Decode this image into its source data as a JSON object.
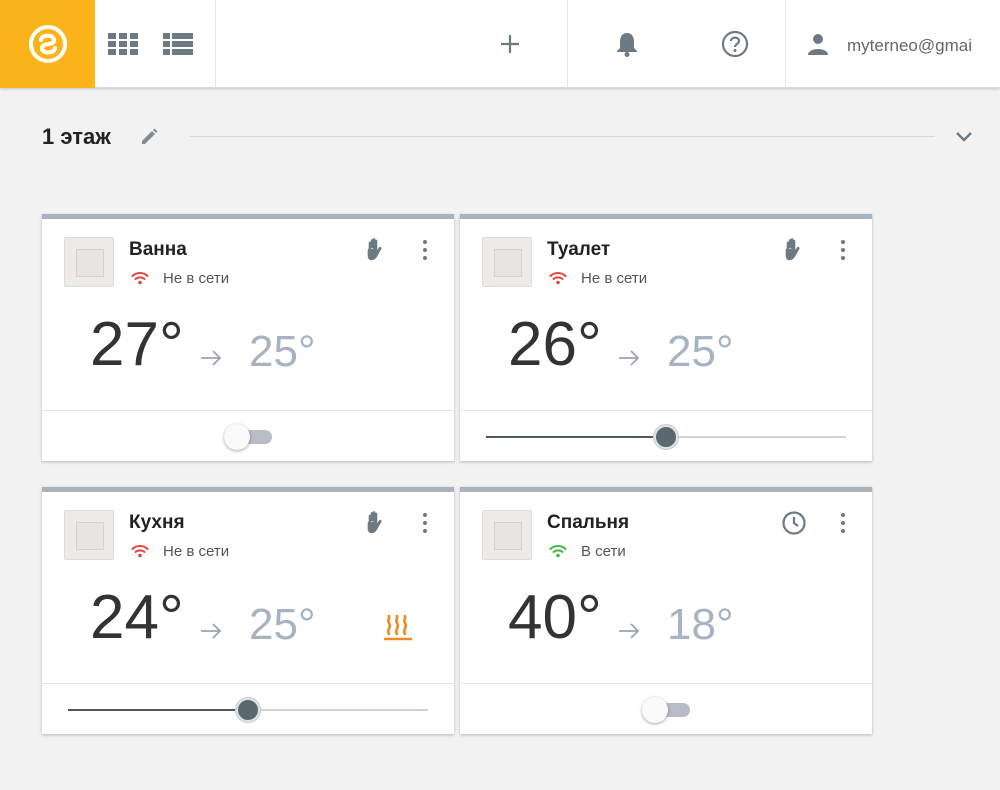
{
  "header": {
    "user_email": "myterneo@gmai",
    "icons": [
      "logo-icon",
      "grid-view-icon",
      "list-view-icon",
      "plus-icon",
      "bell-icon",
      "help-icon",
      "user-icon"
    ]
  },
  "floor": {
    "title": "1 этаж"
  },
  "colors": {
    "brand": "#fbb41a",
    "offline_wifi": "#e2473b",
    "online_wifi": "#45b649",
    "heating": "#f08a1c",
    "target_temp": "#a8b3c2"
  },
  "devices": [
    {
      "name": "Ванна",
      "status": "Не в сети",
      "online": false,
      "current": "27°",
      "target": "25°",
      "mode_icon": "hand-icon",
      "heating": false,
      "control": "toggle",
      "toggle_on": false
    },
    {
      "name": "Туалет",
      "status": "Не в сети",
      "online": false,
      "current": "26°",
      "target": "25°",
      "mode_icon": "hand-icon",
      "heating": false,
      "control": "slider",
      "slider_fraction": 0.5
    },
    {
      "name": "Кухня",
      "status": "Не в сети",
      "online": false,
      "current": "24°",
      "target": "25°",
      "mode_icon": "hand-icon",
      "heating": true,
      "control": "slider",
      "slider_fraction": 0.5
    },
    {
      "name": "Спальня",
      "status": "В сети",
      "online": true,
      "current": "40°",
      "target": "18°",
      "mode_icon": "clock-icon",
      "heating": false,
      "control": "toggle",
      "toggle_on": false
    }
  ]
}
